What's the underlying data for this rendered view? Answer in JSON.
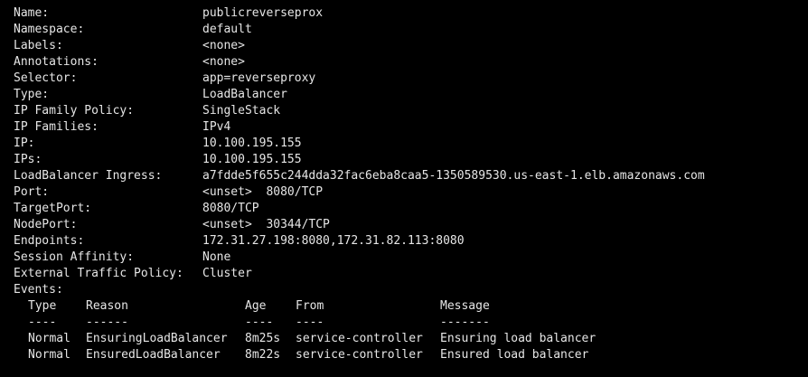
{
  "fields": [
    {
      "key": "Name:",
      "value": "publicreverseprox"
    },
    {
      "key": "Namespace:",
      "value": "default"
    },
    {
      "key": "Labels:",
      "value": "<none>"
    },
    {
      "key": "Annotations:",
      "value": "<none>"
    },
    {
      "key": "Selector:",
      "value": "app=reverseproxy"
    },
    {
      "key": "Type:",
      "value": "LoadBalancer"
    },
    {
      "key": "IP Family Policy:",
      "value": "SingleStack"
    },
    {
      "key": "IP Families:",
      "value": "IPv4"
    },
    {
      "key": "IP:",
      "value": "10.100.195.155"
    },
    {
      "key": "IPs:",
      "value": "10.100.195.155"
    },
    {
      "key": "LoadBalancer Ingress:",
      "value": "a7fdde5f655c244dda32fac6eba8caa5-1350589530.us-east-1.elb.amazonaws.com"
    },
    {
      "key": "Port:",
      "value": "<unset>  8080/TCP"
    },
    {
      "key": "TargetPort:",
      "value": "8080/TCP"
    },
    {
      "key": "NodePort:",
      "value": "<unset>  30344/TCP"
    },
    {
      "key": "Endpoints:",
      "value": "172.31.27.198:8080,172.31.82.113:8080"
    },
    {
      "key": "Session Affinity:",
      "value": "None"
    },
    {
      "key": "External Traffic Policy:",
      "value": "Cluster"
    }
  ],
  "events": {
    "label": "Events:",
    "headers": {
      "type": "Type",
      "reason": "Reason",
      "age": "Age",
      "from": "From",
      "message": "Message"
    },
    "separators": {
      "type": "----",
      "reason": "------",
      "age": "----",
      "from": "----",
      "message": "-------"
    },
    "rows": [
      {
        "type": "Normal",
        "reason": "EnsuringLoadBalancer",
        "age": "8m25s",
        "from": "service-controller",
        "message": "Ensuring load balancer"
      },
      {
        "type": "Normal",
        "reason": "EnsuredLoadBalancer",
        "age": "8m22s",
        "from": "service-controller",
        "message": "Ensured load balancer"
      }
    ]
  },
  "colors": {
    "background": "#000000",
    "text": "#e6e6e6"
  }
}
